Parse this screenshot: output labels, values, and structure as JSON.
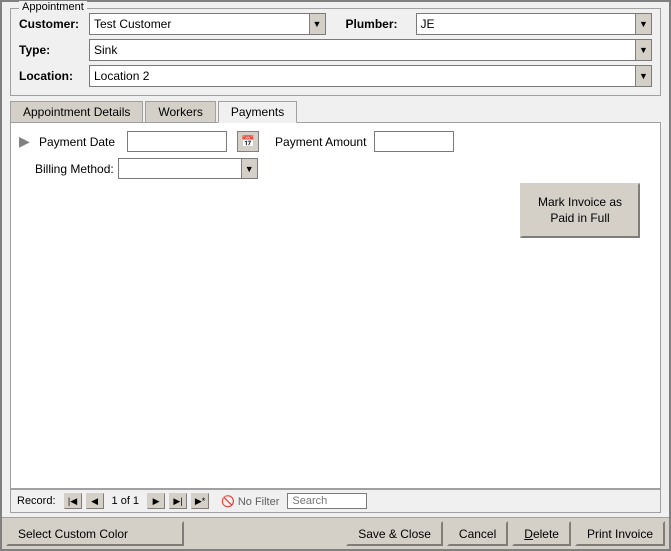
{
  "window": {
    "title": "Appointment"
  },
  "appointment": {
    "group_label": "Appointment",
    "customer_label": "Customer:",
    "customer_value": "Test Customer",
    "plumber_label": "Plumber:",
    "plumber_value": "JE",
    "type_label": "Type:",
    "type_value": "Sink",
    "location_label": "Location:",
    "location_value": "Location 2"
  },
  "tabs": [
    {
      "id": "appointment-details",
      "label": "Appointment Details"
    },
    {
      "id": "workers",
      "label": "Workers"
    },
    {
      "id": "payments",
      "label": "Payments"
    }
  ],
  "payments": {
    "payment_date_label": "Payment Date",
    "payment_date_value": "",
    "payment_date_placeholder": "",
    "calendar_icon": "📅",
    "payment_amount_label": "Payment Amount",
    "payment_amount_value": "",
    "billing_method_label": "Billing Method:",
    "billing_method_value": "",
    "mark_invoice_label": "Mark Invoice as Paid in Full"
  },
  "record_nav": {
    "record_label": "Record:",
    "first_icon": "⏮",
    "prev_icon": "◀",
    "record_info": "1 of 1",
    "next_icon": "▶",
    "last_icon": "⏭",
    "new_icon": "▶*",
    "filter_icon": "🚫",
    "filter_label": "No Filter",
    "search_placeholder": "Search"
  },
  "bottom_bar": {
    "select_color_label": "Select Custom Color",
    "save_close_label": "Save & Close",
    "cancel_label": "Cancel",
    "delete_label": "Delete",
    "delete_underline_char": "D",
    "print_invoice_label": "Print Invoice"
  }
}
